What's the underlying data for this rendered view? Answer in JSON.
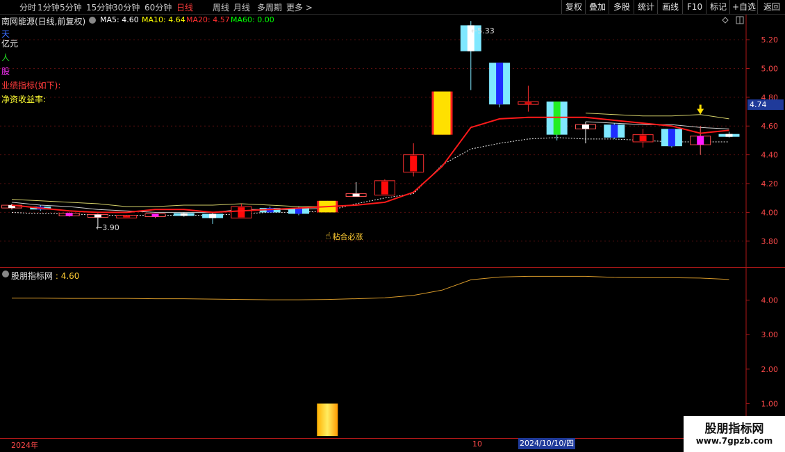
{
  "toolbar": {
    "periods": [
      "分时",
      "1分钟",
      "5分钟",
      "15分钟",
      "30分钟",
      "60分钟",
      "日线",
      "周线",
      "月线",
      "多周期",
      "更多 >"
    ],
    "active_period": "日线",
    "right_buttons": [
      "复权",
      "叠加",
      "多股",
      "统计",
      "画线",
      "F10",
      "标记",
      "+自选",
      "返回"
    ]
  },
  "header": {
    "stock_title": "南网能源(日线,前复权)",
    "ma": [
      {
        "label": "MA5: 4.60",
        "color": "#ffffff"
      },
      {
        "label": "MA10: 4.64",
        "color": "#ffff00"
      },
      {
        "label": "MA20: 4.57",
        "color": "#ff3030"
      },
      {
        "label": "MA60: 0.00",
        "color": "#00ff00"
      }
    ]
  },
  "side_labels": [
    {
      "text": "天",
      "color": "#3a6bff"
    },
    {
      "text": "亿元",
      "color": "#ffffff"
    },
    {
      "text": "人",
      "color": "#22dd22"
    },
    {
      "text": "股",
      "color": "#ff33ff"
    },
    {
      "text": "业绩指标(如下):",
      "color": "#ff3b3b"
    },
    {
      "text": "净资收益率:",
      "color": "#ffff33"
    }
  ],
  "annotations": {
    "high": "5.33",
    "low": "3.90",
    "signal": "粘合必涨"
  },
  "price_badge": "4.74",
  "indicator": {
    "name": "股朋指标网",
    "value": ": 4.60"
  },
  "dates": {
    "year": "2024年",
    "month": "10",
    "cursor": "2024/10/10/四"
  },
  "watermark": {
    "line1": "股朋指标网",
    "line2": "www.7gpzb.com"
  },
  "chart_data": {
    "type": "candlestick",
    "price_axis": {
      "ticks": [
        3.8,
        4.0,
        4.2,
        4.4,
        4.6,
        4.8,
        5.0,
        5.2
      ],
      "range": [
        3.62,
        5.36
      ]
    },
    "indicator_axis": {
      "ticks": [
        1.0,
        2.0,
        3.0,
        4.0
      ],
      "range": [
        0.0,
        4.92
      ]
    },
    "candles": [
      {
        "o": 4.04,
        "h": 4.06,
        "l": 4.02,
        "c": 4.04,
        "color": "white"
      },
      {
        "o": 4.04,
        "h": 4.05,
        "l": 4.01,
        "c": 4.02,
        "color": "blue"
      },
      {
        "o": 3.99,
        "h": 4.0,
        "l": 3.97,
        "c": 3.98,
        "color": "magenta"
      },
      {
        "o": 3.98,
        "h": 3.99,
        "l": 3.9,
        "c": 3.97,
        "color": "white"
      },
      {
        "o": 3.97,
        "h": 3.98,
        "l": 3.96,
        "c": 3.97,
        "color": "red"
      },
      {
        "o": 3.97,
        "h": 3.99,
        "l": 3.96,
        "c": 3.99,
        "color": "magenta"
      },
      {
        "o": 3.99,
        "h": 4.0,
        "l": 3.97,
        "c": 3.98,
        "color": "cyan"
      },
      {
        "o": 3.99,
        "h": 4.0,
        "l": 3.92,
        "c": 3.96,
        "color": "cyan"
      },
      {
        "o": 3.96,
        "h": 4.06,
        "l": 3.96,
        "c": 4.04,
        "color": "red"
      },
      {
        "o": 4.03,
        "h": 4.04,
        "l": 4.0,
        "c": 4.0,
        "color": "blue"
      },
      {
        "o": 4.03,
        "h": 4.04,
        "l": 3.98,
        "c": 3.99,
        "color": "blue"
      },
      {
        "o": 4.0,
        "h": 4.08,
        "l": 4.0,
        "c": 4.08,
        "color": "yellow"
      },
      {
        "o": 4.12,
        "h": 4.21,
        "l": 4.12,
        "c": 4.12,
        "color": "white"
      },
      {
        "o": 4.12,
        "h": 4.23,
        "l": 4.12,
        "c": 4.22,
        "color": "red"
      },
      {
        "o": 4.28,
        "h": 4.48,
        "l": 4.25,
        "c": 4.4,
        "color": "red"
      },
      {
        "o": 4.54,
        "h": 4.84,
        "l": 4.54,
        "c": 4.84,
        "color": "yellow"
      },
      {
        "o": 5.12,
        "h": 5.33,
        "l": 4.85,
        "c": 5.3,
        "color": "cyan"
      },
      {
        "o": 5.04,
        "h": 5.04,
        "l": 4.73,
        "c": 4.75,
        "color": "blue"
      },
      {
        "o": 4.76,
        "h": 4.88,
        "l": 4.7,
        "c": 4.76,
        "color": "red"
      },
      {
        "o": 4.77,
        "h": 4.77,
        "l": 4.5,
        "c": 4.54,
        "color": "green"
      },
      {
        "o": 4.61,
        "h": 4.63,
        "l": 4.48,
        "c": 4.58,
        "color": "white"
      },
      {
        "o": 4.61,
        "h": 4.62,
        "l": 4.51,
        "c": 4.52,
        "color": "blue"
      },
      {
        "o": 4.54,
        "h": 4.58,
        "l": 4.45,
        "c": 4.49,
        "color": "red"
      },
      {
        "o": 4.58,
        "h": 4.58,
        "l": 4.45,
        "c": 4.46,
        "color": "blue"
      },
      {
        "o": 4.47,
        "h": 4.6,
        "l": 4.4,
        "c": 4.53,
        "color": "magenta"
      },
      {
        "o": 4.54,
        "h": 4.56,
        "l": 4.52,
        "c": 4.53,
        "color": "cyan"
      }
    ],
    "ma_red": [
      4.05,
      4.03,
      4.01,
      4.0,
      4.0,
      4.02,
      4.02,
      4.0,
      4.01,
      4.02,
      4.03,
      4.04,
      4.05,
      4.07,
      4.14,
      4.32,
      4.59,
      4.65,
      4.66,
      4.66,
      4.66,
      4.64,
      4.62,
      4.6,
      4.55,
      4.57
    ],
    "ma_yellow": [
      4.09,
      4.08,
      4.07,
      4.06,
      4.04,
      4.04,
      4.05,
      4.05,
      4.06,
      4.05,
      4.04,
      4.04,
      null,
      null,
      null,
      null,
      null,
      null,
      null,
      null,
      4.69,
      4.68,
      4.67,
      4.67,
      4.68,
      4.65
    ],
    "ma_white": [
      4.07,
      4.05,
      4.04,
      4.02,
      4.01,
      4.0,
      4.0,
      4.0,
      4.02,
      4.02,
      4.02,
      4.03,
      null,
      null,
      null,
      null,
      null,
      null,
      null,
      null,
      4.63,
      4.62,
      4.61,
      4.61,
      4.59,
      4.58
    ],
    "ma_dashed": [
      4.0,
      3.99,
      3.99,
      3.98,
      3.98,
      3.98,
      3.98,
      3.98,
      3.99,
      4.0,
      4.0,
      4.01,
      4.06,
      4.1,
      4.13,
      4.33,
      4.44,
      4.48,
      4.51,
      4.52,
      4.51,
      4.51,
      4.5,
      4.49,
      4.49,
      4.49
    ],
    "indicator_line": [
      4.06,
      4.06,
      4.05,
      4.05,
      4.05,
      4.04,
      4.04,
      4.03,
      4.02,
      4.01,
      4.01,
      4.02,
      4.04,
      4.07,
      4.14,
      4.29,
      4.59,
      4.67,
      4.69,
      4.69,
      4.69,
      4.66,
      4.65,
      4.65,
      4.64,
      4.6
    ],
    "indicator_bar": {
      "index": 11,
      "value": 1.0
    }
  }
}
